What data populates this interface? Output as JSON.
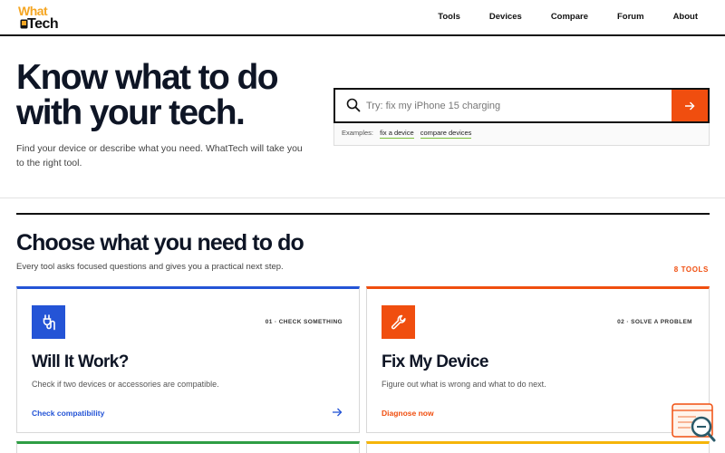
{
  "header": {
    "logo_what": "What",
    "logo_tech": "Tech",
    "nav": [
      "Tools",
      "Devices",
      "Compare",
      "Forum",
      "About"
    ]
  },
  "hero": {
    "title_line1": "Know what to do",
    "title_line2": "with your tech.",
    "subtitle": "Find your device or describe what you need. WhatTech will take you to the right tool.",
    "search_placeholder": "Try: fix my iPhone 15 charging",
    "examples_label": "Examples:",
    "examples": [
      "fix a device",
      "compare devices"
    ]
  },
  "section": {
    "title": "Choose what you need to do",
    "subtitle": "Every tool asks focused questions and gives you a practical next step.",
    "tool_count": "8 TOOLS"
  },
  "cards": [
    {
      "tag": "01 · CHECK SOMETHING",
      "title": "Will It Work?",
      "description": "Check if two devices or accessories are compatible.",
      "link": "Check compatibility",
      "icon": "plug-icon",
      "color": "#2454d6"
    },
    {
      "tag": "02 · SOLVE A PROBLEM",
      "title": "Fix My Device",
      "description": "Figure out what is wrong and what to do next.",
      "link": "Diagnose now",
      "icon": "wrench-icon",
      "color": "#f04e0f"
    }
  ],
  "colors": {
    "accent_orange": "#f04e0f",
    "accent_blue": "#2454d6",
    "logo_yellow": "#f5a623",
    "peek_green": "#2e9e44",
    "peek_yellow": "#f5b50a"
  }
}
